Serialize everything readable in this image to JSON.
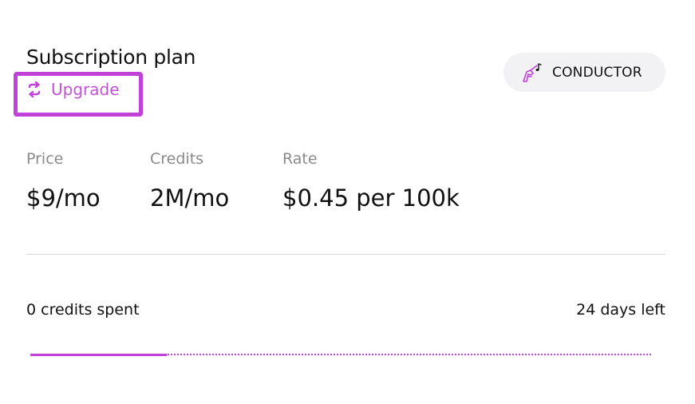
{
  "header": {
    "title": "Subscription plan",
    "upgrade_label": "Upgrade",
    "upgrade_icon": "refresh-icon",
    "plan_badge": {
      "label": "CONDUCTOR",
      "icon": "conductor-hand-music-icon"
    }
  },
  "stats": [
    {
      "label": "Price",
      "value": "$9/mo"
    },
    {
      "label": "Credits",
      "value": "2M/mo"
    },
    {
      "label": "Rate",
      "value": "$0.45 per 100k"
    }
  ],
  "usage": {
    "spent_text": "0 credits spent",
    "days_left_text": "24 days left",
    "progress_fraction": 0.22
  },
  "colors": {
    "accent": "#c042d8",
    "muted_text": "#8a8a8a",
    "badge_bg": "#f2f2f4"
  }
}
